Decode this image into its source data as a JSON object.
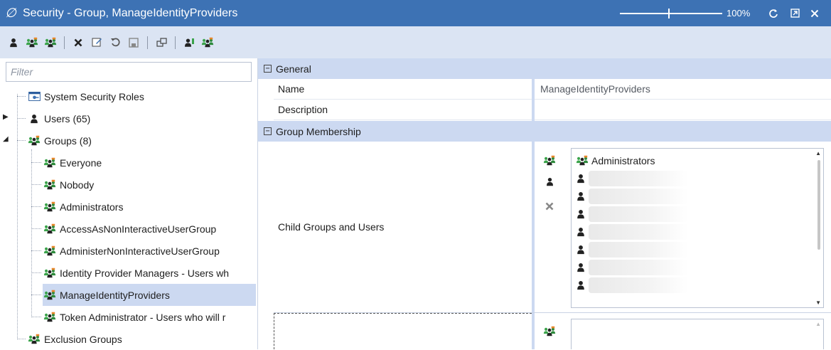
{
  "window": {
    "title": "Security - Group, ManageIdentityProviders",
    "zoom_label": "100%",
    "zoom_value": 0.5
  },
  "icons": {
    "app_logo": "app-logo-icon",
    "refresh": "refresh-icon",
    "restore": "restore-window-icon",
    "close": "close-icon"
  },
  "toolbar": {
    "buttons": [
      "add-user-icon",
      "add-group-icon",
      "add-group-alt-icon",
      "delete-icon",
      "edit-icon",
      "undo-icon",
      "save-icon",
      "window-icon",
      "user-permissions-icon",
      "identity-icon"
    ]
  },
  "left": {
    "filter_placeholder": "Filter",
    "tree": [
      {
        "label": "System Security Roles",
        "icon": "security-roles-icon"
      },
      {
        "label": "Users (65)",
        "icon": "user-icon"
      },
      {
        "label": "Groups (8)",
        "icon": "group-icon"
      },
      {
        "label": "Everyone",
        "icon": "group-icon"
      },
      {
        "label": "Nobody",
        "icon": "group-icon"
      },
      {
        "label": "Administrators",
        "icon": "group-icon"
      },
      {
        "label": "AccessAsNonInteractiveUserGroup",
        "icon": "group-icon"
      },
      {
        "label": "AdministerNonInteractiveUserGroup",
        "icon": "group-icon"
      },
      {
        "label": "Identity Provider Managers - Users wh",
        "icon": "group-icon"
      },
      {
        "label": "ManageIdentityProviders",
        "icon": "group-icon",
        "selected": true
      },
      {
        "label": "Token Administrator - Users who will r",
        "icon": "group-icon"
      },
      {
        "label": "Exclusion Groups",
        "icon": "group-icon"
      }
    ]
  },
  "properties": {
    "general_header": "General",
    "name_label": "Name",
    "name_value": "ManageIdentityProviders",
    "description_label": "Description",
    "description_value": "",
    "membership_header": "Group Membership",
    "child_label": "Child Groups and Users",
    "members": [
      {
        "label": "Administrators",
        "icon": "group-icon"
      },
      {
        "label": "",
        "icon": "user-icon"
      },
      {
        "label": "",
        "icon": "user-icon"
      },
      {
        "label": "",
        "icon": "user-icon"
      },
      {
        "label": "",
        "icon": "user-icon"
      },
      {
        "label": "",
        "icon": "user-icon"
      },
      {
        "label": "",
        "icon": "user-icon"
      },
      {
        "label": "",
        "icon": "user-icon"
      }
    ]
  },
  "colors": {
    "title_bar": "#3d72b4",
    "toolbar": "#dbe4f3",
    "selection": "#ccd9f1",
    "group_green": "#3aa34a",
    "group_orange": "#e8862a"
  }
}
